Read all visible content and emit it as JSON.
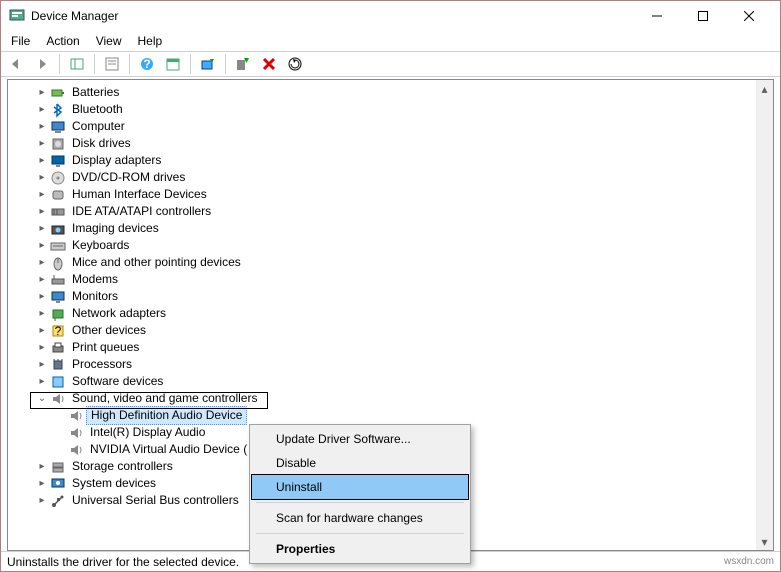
{
  "window": {
    "title": "Device Manager"
  },
  "menubar": {
    "file": "File",
    "action": "Action",
    "view": "View",
    "help": "Help"
  },
  "tree": {
    "items": [
      {
        "label": "Batteries",
        "icon": "battery"
      },
      {
        "label": "Bluetooth",
        "icon": "bluetooth"
      },
      {
        "label": "Computer",
        "icon": "computer"
      },
      {
        "label": "Disk drives",
        "icon": "disk"
      },
      {
        "label": "Display adapters",
        "icon": "display"
      },
      {
        "label": "DVD/CD-ROM drives",
        "icon": "cdrom"
      },
      {
        "label": "Human Interface Devices",
        "icon": "hid"
      },
      {
        "label": "IDE ATA/ATAPI controllers",
        "icon": "ide"
      },
      {
        "label": "Imaging devices",
        "icon": "imaging"
      },
      {
        "label": "Keyboards",
        "icon": "keyboard"
      },
      {
        "label": "Mice and other pointing devices",
        "icon": "mouse"
      },
      {
        "label": "Modems",
        "icon": "modem"
      },
      {
        "label": "Monitors",
        "icon": "monitor"
      },
      {
        "label": "Network adapters",
        "icon": "network"
      },
      {
        "label": "Other devices",
        "icon": "other"
      },
      {
        "label": "Print queues",
        "icon": "printer"
      },
      {
        "label": "Processors",
        "icon": "cpu"
      },
      {
        "label": "Software devices",
        "icon": "software"
      }
    ],
    "expanded": {
      "label": "Sound, video and game controllers",
      "children": [
        {
          "label": "High Definition Audio Device"
        },
        {
          "label": "Intel(R) Display Audio"
        },
        {
          "label": "NVIDIA Virtual Audio Device ("
        }
      ]
    },
    "after": [
      {
        "label": "Storage controllers",
        "icon": "storage"
      },
      {
        "label": "System devices",
        "icon": "system"
      },
      {
        "label": "Universal Serial Bus controllers",
        "icon": "usb"
      }
    ]
  },
  "context_menu": {
    "items": [
      "Update Driver Software...",
      "Disable",
      "Uninstall",
      "Scan for hardware changes",
      "Properties"
    ]
  },
  "status": {
    "text": "Uninstalls the driver for the selected device.",
    "watermark": "wsxdn.com"
  }
}
